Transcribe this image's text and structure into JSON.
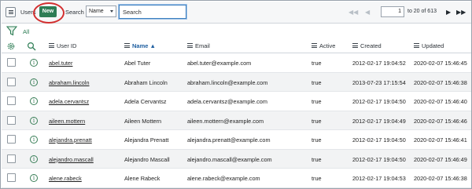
{
  "header": {
    "list_title": "Users",
    "new_button": "New",
    "search_label": "Search",
    "field_selected": "Name",
    "search_placeholder": "Search",
    "page_current": "1",
    "page_range_text": "to 20 of 613"
  },
  "filter": {
    "breadcrumb_all": "All"
  },
  "columns": {
    "user_id": "User ID",
    "name": "Name",
    "email": "Email",
    "active": "Active",
    "created": "Created",
    "updated": "Updated"
  },
  "sort": {
    "column": "Name",
    "direction": "ascending"
  },
  "colors": {
    "accent": "#2e7d55",
    "highlight_ring": "#d32f2f",
    "row_alt": "#f2f3f4",
    "sorted_header": "#1f5fa0"
  },
  "rows": [
    {
      "user_id": "abel.tuter",
      "name": "Abel Tuter",
      "email": "abel.tuter@example.com",
      "active": "true",
      "created": "2012-02-17 19:04:52",
      "updated": "2020-02-07 15:46:45"
    },
    {
      "user_id": "abraham.lincoln",
      "name": "Abraham Lincoln",
      "email": "abraham.lincoln@example.com",
      "active": "true",
      "created": "2013-07-23 17:15:54",
      "updated": "2020-02-07 15:46:38"
    },
    {
      "user_id": "adela.cervantsz",
      "name": "Adela Cervantsz",
      "email": "adela.cervantsz@example.com",
      "active": "true",
      "created": "2012-02-17 19:04:50",
      "updated": "2020-02-07 15:46:40"
    },
    {
      "user_id": "aileen.mottern",
      "name": "Aileen Mottern",
      "email": "aileen.mottern@example.com",
      "active": "true",
      "created": "2012-02-17 19:04:49",
      "updated": "2020-02-07 15:46:46"
    },
    {
      "user_id": "alejandra.prenatt",
      "name": "Alejandra Prenatt",
      "email": "alejandra.prenatt@example.com",
      "active": "true",
      "created": "2012-02-17 19:04:50",
      "updated": "2020-02-07 15:46:41"
    },
    {
      "user_id": "alejandro.mascall",
      "name": "Alejandro Mascall",
      "email": "alejandro.mascall@example.com",
      "active": "true",
      "created": "2012-02-17 19:04:50",
      "updated": "2020-02-07 15:46:49"
    },
    {
      "user_id": "alene.rabeck",
      "name": "Alene Rabeck",
      "email": "alene.rabeck@example.com",
      "active": "true",
      "created": "2012-02-17 19:04:53",
      "updated": "2020-02-07 15:46:38"
    }
  ]
}
